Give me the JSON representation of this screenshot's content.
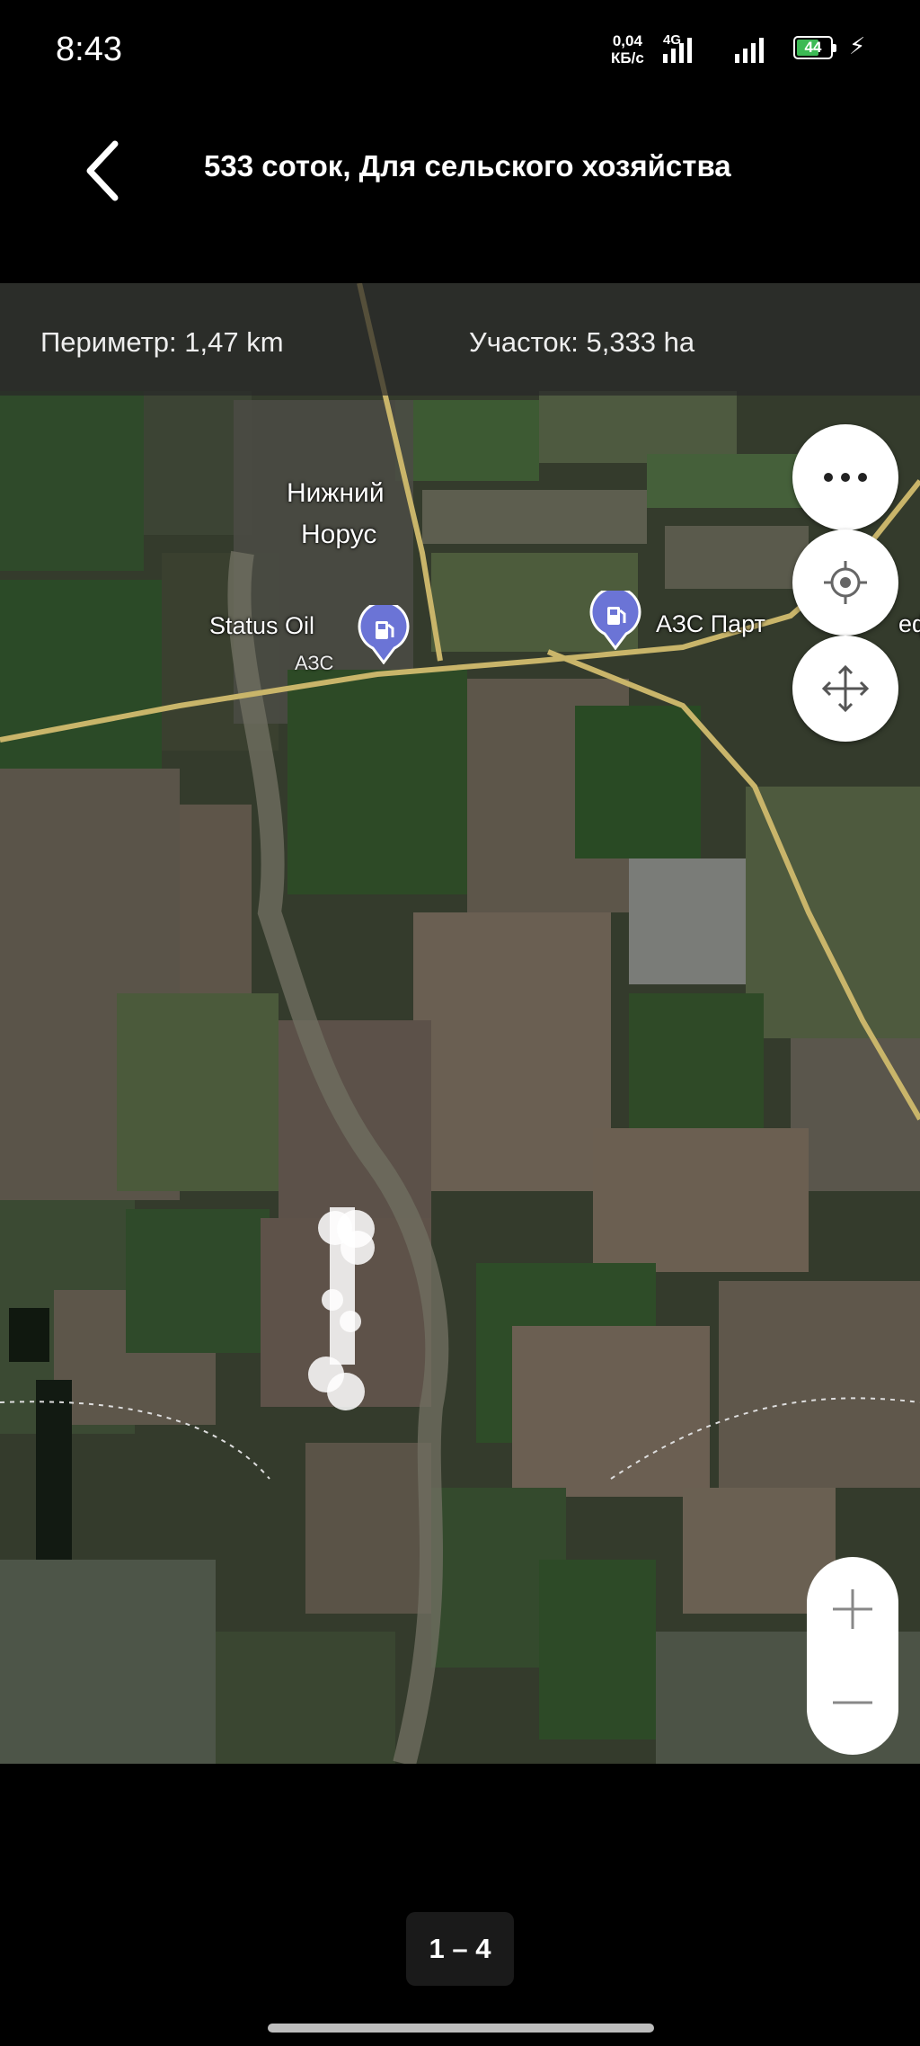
{
  "status": {
    "time": "8:43",
    "net_speed_value": "0,04",
    "net_speed_unit": "КБ/с",
    "net_type": "4G",
    "battery_level": "44"
  },
  "header": {
    "title": "533 соток, Для сельского хозяйства"
  },
  "map": {
    "perimeter": "Периметр: 1,47 km",
    "area": "Участок: 5,333 ha",
    "village_line1": "Нижний",
    "village_line2": "Норус",
    "poi_status_oil": "Status Oil",
    "poi_status_oil_sub": "АЗС",
    "poi_azs": "АЗС Парт",
    "poi_azs_tail": "еф"
  },
  "pager": {
    "label": "1 – 4"
  }
}
